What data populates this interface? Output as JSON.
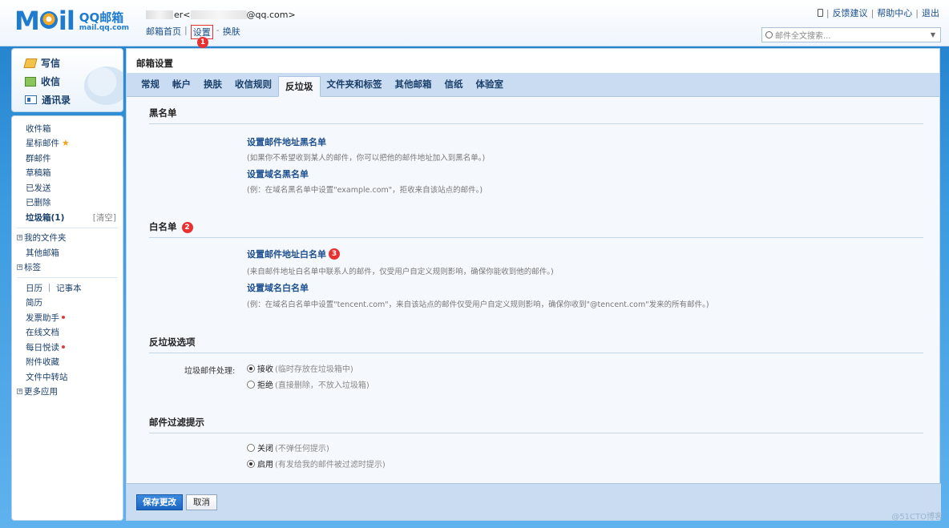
{
  "logo": {
    "mail_text": "Mail",
    "qq_text": "QQ邮箱",
    "url_text": "mail.qq.com"
  },
  "user": {
    "email_prefix": "er<",
    "email_suffix": "@qq.com>"
  },
  "header_links": {
    "home": "邮箱首页",
    "separator": "|",
    "settings": "设置",
    "dash": "-",
    "skin": "换肤"
  },
  "top_links": {
    "feedback": "反馈建议",
    "help": "帮助中心",
    "logout": "退出",
    "sep": "|"
  },
  "search": {
    "placeholder": "邮件全文搜索..."
  },
  "badges": {
    "b1": "1",
    "b2": "2",
    "b3": "3"
  },
  "sidebar": {
    "write": "写信",
    "receive": "收信",
    "contacts": "通讯录",
    "items": {
      "inbox": "收件箱",
      "starred": "星标邮件",
      "star": "★",
      "group": "群邮件",
      "drafts": "草稿箱",
      "sent": "已发送",
      "deleted": "已删除",
      "spam": "垃圾箱(1)",
      "clear": "[清空]",
      "my_folders": "我的文件夹",
      "other_mailbox": "其他邮箱",
      "tags": "标签",
      "calendar_notes": "日历 ｜ 记事本",
      "resume": "简历",
      "invoice": "发票助手",
      "docs": "在线文档",
      "daily": "每日悦读",
      "attachments": "附件收藏",
      "transfer": "文件中转站",
      "more_apps": "更多应用",
      "plus": "⊞"
    }
  },
  "main": {
    "title": "邮箱设置",
    "tabs": [
      "常规",
      "帐户",
      "换肤",
      "收信规则",
      "反垃圾",
      "文件夹和标签",
      "其他邮箱",
      "信纸",
      "体验室"
    ],
    "active_tab": "反垃圾",
    "blacklist": {
      "title": "黑名单",
      "addr_link": "设置邮件地址黑名单",
      "addr_desc": "(如果你不希望收到某人的邮件，你可以把他的邮件地址加入到黑名单。)",
      "domain_link": "设置域名黑名单",
      "domain_desc": "(例：在域名黑名单中设置\"example.com\"，拒收来自该站点的邮件。)"
    },
    "whitelist": {
      "title": "白名单",
      "addr_link": "设置邮件地址白名单",
      "addr_desc": "(来自邮件地址白名单中联系人的邮件，仅受用户自定义规则影响，确保你能收到他的邮件。)",
      "domain_link": "设置域名白名单",
      "domain_desc": "(例：在域名白名单中设置\"tencent.com\"，来自该站点的邮件仅受用户自定义规则影响，确保你收到\"@tencent.com\"发来的所有邮件。)"
    },
    "antispam": {
      "title": "反垃圾选项",
      "label": "垃圾邮件处理:",
      "opt1": "接收",
      "opt1_hint": "(临时存放在垃圾箱中)",
      "opt2": "拒绝",
      "opt2_hint": "(直接删除，不放入垃圾箱)",
      "selected": "接收"
    },
    "filter": {
      "title": "邮件过滤提示",
      "opt1": "关闭",
      "opt1_hint": "(不弹任何提示)",
      "opt2": "启用",
      "opt2_hint": "(有发给我的邮件被过滤时提示)",
      "selected": "启用"
    },
    "buttons": {
      "save": "保存更改",
      "cancel": "取消"
    }
  },
  "watermark": "@51CTO博客"
}
